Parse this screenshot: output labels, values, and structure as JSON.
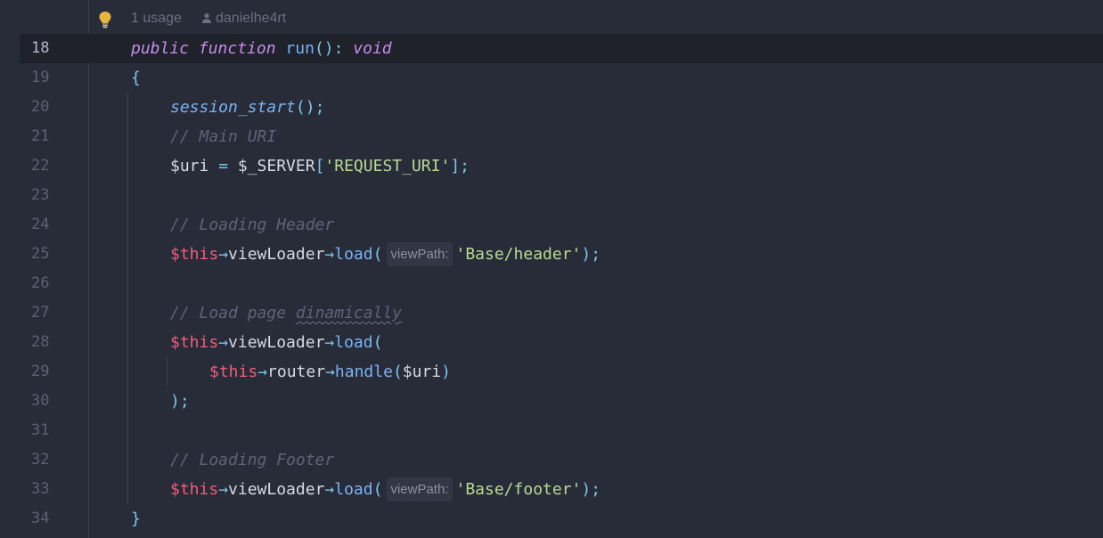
{
  "inlay": {
    "usage": "1 usage",
    "author": "danielhe4rt",
    "bulb_icon": "lightbulb-icon",
    "person_icon": "person-icon"
  },
  "colors": {
    "background": "#282b38",
    "current_line": "#1f212b",
    "keyword": "#c58ee8",
    "function": "#7ab3f2",
    "comment": "#5e6478",
    "this": "#ee5e79",
    "string": "#b8da92",
    "punctuation": "#7dc8e8"
  },
  "current_line": "18",
  "lines": [
    {
      "n": "18",
      "tokens": {
        "kw1": "public",
        "kw2": "function",
        "fn": "run",
        "p1": "():",
        "kw3": "void"
      }
    },
    {
      "n": "19",
      "tokens": {
        "p1": "{"
      }
    },
    {
      "n": "20",
      "tokens": {
        "fn": "session_start",
        "p1": "();"
      }
    },
    {
      "n": "21",
      "tokens": {
        "cm": "// Main URI"
      }
    },
    {
      "n": "22",
      "tokens": {
        "v1": "$uri",
        "op": " = ",
        "v2": "$_SERVER",
        "p1": "[",
        "str": "'REQUEST_URI'",
        "p2": "];"
      }
    },
    {
      "n": "23",
      "tokens": {}
    },
    {
      "n": "24",
      "tokens": {
        "cm": "// Loading Header"
      }
    },
    {
      "n": "25",
      "tokens": {
        "this": "$this",
        "a1": "→",
        "prop": "viewLoader",
        "a2": "→",
        "fn": "load",
        "p1": "(",
        "hint": "viewPath:",
        "str": "'Base/header'",
        "p2": ");"
      }
    },
    {
      "n": "26",
      "tokens": {}
    },
    {
      "n": "27",
      "tokens": {
        "cm": "// Load page ",
        "cm_typo": "dinamically"
      }
    },
    {
      "n": "28",
      "tokens": {
        "this": "$this",
        "a1": "→",
        "prop": "viewLoader",
        "a2": "→",
        "fn": "load",
        "p1": "("
      }
    },
    {
      "n": "29",
      "tokens": {
        "this": "$this",
        "a1": "→",
        "prop": "router",
        "a2": "→",
        "fn": "handle",
        "p1": "(",
        "v1": "$uri",
        "p2": ")"
      }
    },
    {
      "n": "30",
      "tokens": {
        "p1": ");"
      }
    },
    {
      "n": "31",
      "tokens": {}
    },
    {
      "n": "32",
      "tokens": {
        "cm": "// Loading Footer"
      }
    },
    {
      "n": "33",
      "tokens": {
        "this": "$this",
        "a1": "→",
        "prop": "viewLoader",
        "a2": "→",
        "fn": "load",
        "p1": "(",
        "hint": "viewPath:",
        "str": "'Base/footer'",
        "p2": ");"
      }
    },
    {
      "n": "34",
      "tokens": {
        "p1": "}"
      }
    }
  ]
}
